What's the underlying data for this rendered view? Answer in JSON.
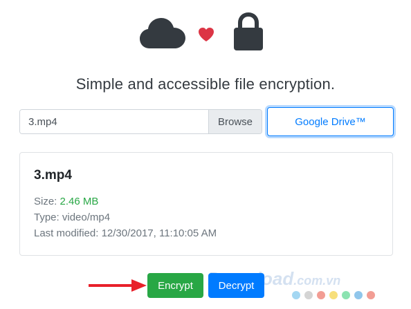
{
  "header": {
    "title": "Simple and accessible file encryption."
  },
  "icons": {
    "cloud": "cloud-icon",
    "heart": "heart-icon",
    "lock": "lock-icon"
  },
  "file_picker": {
    "value": "3.mp4",
    "browse_label": "Browse"
  },
  "google_drive_label": "Google Drive™",
  "file_card": {
    "name": "3.mp4",
    "size_label": "Size:",
    "size_value": "2.46 MB",
    "type_label": "Type:",
    "type_value": "video/mp4",
    "modified_label": "Last modified:",
    "modified_value": "12/30/2017, 11:10:05 AM"
  },
  "actions": {
    "encrypt_label": "Encrypt",
    "decrypt_label": "Decrypt"
  },
  "watermark": {
    "brand": "Download",
    "domain": ".com.vn",
    "dot_colors": [
      "#5ab7e8",
      "#b0b0b0",
      "#e74c3c",
      "#f1c40f",
      "#2ecc71",
      "#3498db",
      "#e74c3c"
    ]
  },
  "colors": {
    "icon_dark": "#343a40",
    "heart": "#dc3545",
    "success": "#28a745",
    "primary": "#007bff",
    "arrow": "#e8202a"
  }
}
